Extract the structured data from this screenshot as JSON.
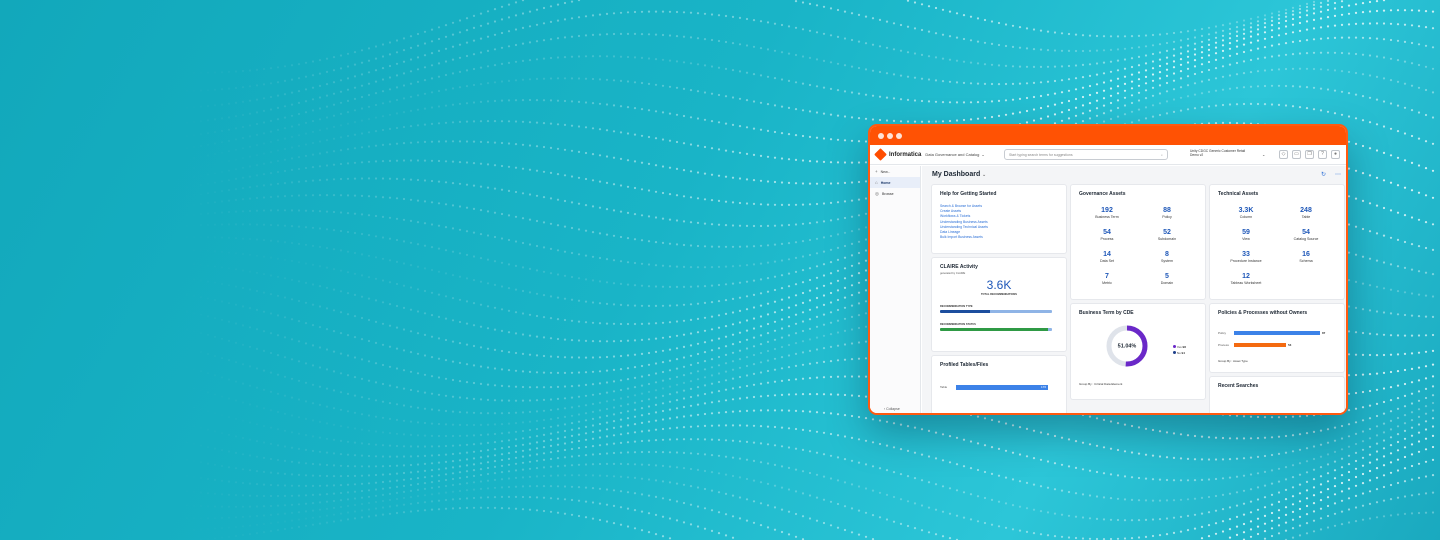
{
  "window": {
    "accent": "#ff5204"
  },
  "header": {
    "brand": "Informatica",
    "product": "Data Governance and Catalog",
    "search_placeholder": "Start typing search terms for suggestions",
    "org_line1": "Unity CDGC Generic Customer Retail",
    "org_line2": "Demo v2"
  },
  "sidebar": {
    "items": [
      {
        "label": "New...",
        "icon": "plus-icon"
      },
      {
        "label": "Home",
        "icon": "home-icon"
      },
      {
        "label": "Browse",
        "icon": "browse-icon"
      }
    ],
    "collapse_label": "Collapse"
  },
  "dashboard": {
    "title": "My Dashboard",
    "help": {
      "title": "Help for Getting Started",
      "links": [
        "Search & Browse for Assets",
        "Create Assets",
        "Workflows & Tickets",
        "Understanding Business Assets",
        "Understanding Technical Assets",
        "Data Lineage",
        "Bulk Import Business Assets"
      ]
    },
    "governance": {
      "title": "Governance Assets",
      "stats": [
        {
          "value": "192",
          "label": "Business Term"
        },
        {
          "value": "88",
          "label": "Policy"
        },
        {
          "value": "54",
          "label": "Process"
        },
        {
          "value": "52",
          "label": "Subdomain"
        },
        {
          "value": "14",
          "label": "Data Set"
        },
        {
          "value": "8",
          "label": "System"
        },
        {
          "value": "7",
          "label": "Metric"
        },
        {
          "value": "5",
          "label": "Domain"
        }
      ]
    },
    "technical": {
      "title": "Technical Assets",
      "stats": [
        {
          "value": "3.3K",
          "label": "Column"
        },
        {
          "value": "248",
          "label": "Table"
        },
        {
          "value": "59",
          "label": "View"
        },
        {
          "value": "54",
          "label": "Catalog Source"
        },
        {
          "value": "33",
          "label": "Procedure Instance"
        },
        {
          "value": "16",
          "label": "Schema"
        },
        {
          "value": "12",
          "label": "Tableau Worksheet"
        }
      ]
    },
    "claire": {
      "title": "CLAIRE Activity",
      "subtitle": "generated by CLAIRE",
      "total": "3.6K",
      "total_label": "TOTAL RECOMMENDATIONS",
      "type_label": "RECOMMENDATION TYPE",
      "status_label": "RECOMMENDATION STATUS",
      "type_split": [
        0.45,
        0.55
      ],
      "status_split": [
        0.96,
        0.04
      ]
    },
    "cde": {
      "title": "Business Term by CDE",
      "percent": "51.04%",
      "fraction": 0.5104,
      "legend": [
        {
          "label": "Yes",
          "value": "98"
        },
        {
          "label": "No",
          "value": "94"
        }
      ],
      "group_by": "Group By : Critical Data Element"
    },
    "owners": {
      "title": "Policies & Processes without Owners",
      "rows": [
        {
          "label": "Policy",
          "value": "87",
          "fraction": 1.0
        },
        {
          "label": "Process",
          "value": "53",
          "fraction": 0.61
        }
      ],
      "group_by": "Group By : Asset Type"
    },
    "profiled": {
      "title": "Profiled Tables/Files",
      "row_label": "Table",
      "row_value": "176"
    },
    "recent": {
      "title": "Recent Searches"
    }
  }
}
